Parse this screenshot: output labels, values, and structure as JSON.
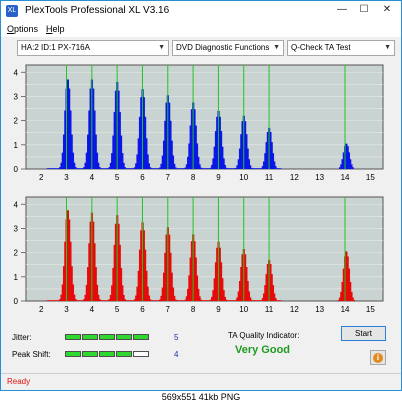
{
  "window": {
    "title": "PlexTools Professional XL V3.16",
    "app_icon": "XL"
  },
  "menu": [
    {
      "label": "Options",
      "underline": "O",
      "rest": "ptions"
    },
    {
      "label": "Help",
      "underline": "H",
      "rest": "elp"
    }
  ],
  "toolbar": {
    "drive": "HA:2 ID:1  PX-716A",
    "function": "DVD Diagnostic Functions",
    "test": "Q-Check TA Test"
  },
  "colors": {
    "top_bars": "#0a17e6",
    "bottom_bars": "#e60a0a",
    "marker": "#22c522",
    "plot_bg": "#c9d3d1",
    "meter_on": "#2fd82f",
    "meter_off": "#ffffff"
  },
  "chart_data": [
    {
      "type": "bar",
      "title": "",
      "xlabel": "",
      "ylabel": "",
      "xlim": [
        1.4,
        15.5
      ],
      "ylim": [
        0,
        4.3
      ],
      "xticks": [
        "2",
        "3",
        "4",
        "5",
        "6",
        "7",
        "8",
        "9",
        "10",
        "11",
        "12",
        "13",
        "14",
        "15"
      ],
      "yticks": [
        "0",
        "1",
        "2",
        "3",
        "4"
      ],
      "marker_lines": [
        3,
        4,
        5,
        6,
        7,
        8,
        9,
        10,
        11,
        14
      ],
      "series": [
        {
          "color": "#0a17e6",
          "peaks": [
            {
              "center": 3.05,
              "height": 3.7
            },
            {
              "center": 4.0,
              "height": 3.7
            },
            {
              "center": 5.0,
              "height": 3.6
            },
            {
              "center": 6.0,
              "height": 3.3
            },
            {
              "center": 7.0,
              "height": 3.05
            },
            {
              "center": 8.0,
              "height": 2.75
            },
            {
              "center": 9.0,
              "height": 2.4
            },
            {
              "center": 10.0,
              "height": 2.2
            },
            {
              "center": 11.0,
              "height": 1.7
            },
            {
              "center": 14.05,
              "height": 1.05
            }
          ]
        }
      ]
    },
    {
      "type": "bar",
      "title": "",
      "xlabel": "",
      "ylabel": "",
      "xlim": [
        1.4,
        15.5
      ],
      "ylim": [
        0,
        4.3
      ],
      "xticks": [
        "2",
        "3",
        "4",
        "5",
        "6",
        "7",
        "8",
        "9",
        "10",
        "11",
        "12",
        "13",
        "14",
        "15"
      ],
      "yticks": [
        "0",
        "1",
        "2",
        "3",
        "4"
      ],
      "marker_lines": [
        3,
        4,
        5,
        6,
        7,
        8,
        9,
        10,
        11,
        14
      ],
      "series": [
        {
          "color": "#e60a0a",
          "peaks": [
            {
              "center": 3.05,
              "height": 3.75
            },
            {
              "center": 4.0,
              "height": 3.65
            },
            {
              "center": 5.0,
              "height": 3.55
            },
            {
              "center": 6.0,
              "height": 3.25
            },
            {
              "center": 7.0,
              "height": 3.05
            },
            {
              "center": 8.0,
              "height": 2.75
            },
            {
              "center": 9.0,
              "height": 2.45
            },
            {
              "center": 10.0,
              "height": 2.15
            },
            {
              "center": 11.0,
              "height": 1.7
            },
            {
              "center": 14.05,
              "height": 2.05
            }
          ]
        }
      ]
    }
  ],
  "metrics": {
    "jitter": {
      "label": "Jitter:",
      "value": "5",
      "filled": 5,
      "total": 5
    },
    "peak_shift": {
      "label": "Peak Shift:",
      "value": "4",
      "filled": 4,
      "total": 5
    }
  },
  "ta": {
    "label": "TA Quality Indicator:",
    "value": "Very Good"
  },
  "buttons": {
    "start": "Start",
    "info": "i"
  },
  "status": "Ready",
  "caption": "569x551  41kb  PNG"
}
